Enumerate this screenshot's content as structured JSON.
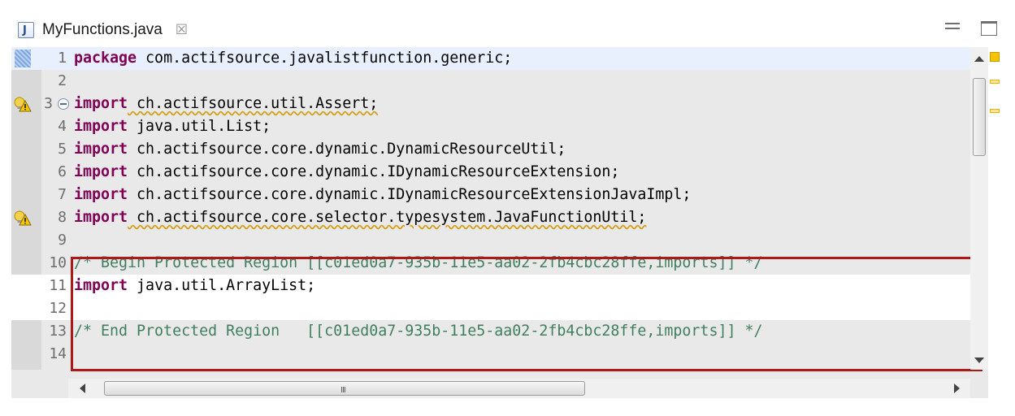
{
  "tab": {
    "title": "MyFunctions.java",
    "icon": "java-file-icon",
    "close_glyph": "☒",
    "icon_letter": "J"
  },
  "window": {
    "minimize_icon": "minimize-icon",
    "maximize_icon": "maximize-icon"
  },
  "editor": {
    "lines": [
      {
        "num": "1",
        "kw": "package",
        "rest": " com.actifsource.javalistfunction.generic;"
      },
      {
        "num": "2",
        "kw": "",
        "rest": ""
      },
      {
        "num": "3",
        "kw": "import",
        "rest": " ch.actifsource.util.Assert;"
      },
      {
        "num": "4",
        "kw": "import",
        "rest": " java.util.List;"
      },
      {
        "num": "5",
        "kw": "import",
        "rest": " ch.actifsource.core.dynamic.DynamicResourceUtil;"
      },
      {
        "num": "6",
        "kw": "import",
        "rest": " ch.actifsource.core.dynamic.IDynamicResourceExtension;"
      },
      {
        "num": "7",
        "kw": "import",
        "rest": " ch.actifsource.core.dynamic.IDynamicResourceExtensionJavaImpl;"
      },
      {
        "num": "8",
        "kw": "import",
        "rest": " ch.actifsource.core.selector.typesystem.JavaFunctionUtil;"
      },
      {
        "num": "9",
        "kw": "",
        "rest": ""
      },
      {
        "num": "10",
        "comment": "/* Begin Protected Region [[c01ed0a7-935b-11e5-aa02-2fb4cbc28ffe,imports]] */"
      },
      {
        "num": "11",
        "kw": "import",
        "rest": " java.util.ArrayList;"
      },
      {
        "num": "12",
        "kw": "",
        "rest": ""
      },
      {
        "num": "13",
        "comment": "/* End Protected Region   [[c01ed0a7-935b-11e5-aa02-2fb4cbc28ffe,imports]] */"
      },
      {
        "num": "14",
        "kw": "",
        "rest": ""
      }
    ],
    "hscroll_grip": "III"
  },
  "colors": {
    "keyword": "#7f0055",
    "comment": "#3f7f5f",
    "protected_border": "#b01818"
  }
}
